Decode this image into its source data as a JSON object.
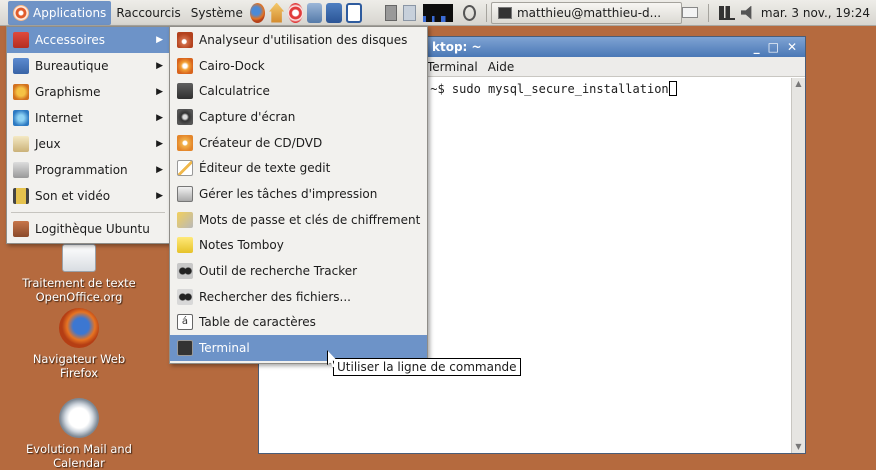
{
  "panel": {
    "menus": [
      "Applications",
      "Raccourcis",
      "Système"
    ],
    "task_label": "matthieu@matthieu-d...",
    "clock": "mar. 3 nov., 19:24"
  },
  "desktop": {
    "icons": [
      {
        "label": "Traitement de texte OpenOffice.org"
      },
      {
        "label": "Navigateur Web Firefox"
      },
      {
        "label": "Evolution Mail and Calendar"
      }
    ]
  },
  "terminal": {
    "title": "ktop: ~",
    "menus": [
      "Terminal",
      "Aide"
    ],
    "prompt_line": ":~$ sudo mysql_secure_installation"
  },
  "main_menu": {
    "items": [
      {
        "label": "Accessoires",
        "icon": "accessories-icon",
        "selected": true
      },
      {
        "label": "Bureautique",
        "icon": "office-icon"
      },
      {
        "label": "Graphisme",
        "icon": "graphics-icon"
      },
      {
        "label": "Internet",
        "icon": "internet-icon"
      },
      {
        "label": "Jeux",
        "icon": "games-icon"
      },
      {
        "label": "Programmation",
        "icon": "programming-icon"
      },
      {
        "label": "Son et vidéo",
        "icon": "sound-video-icon"
      }
    ],
    "footer": {
      "label": "Logithèque Ubuntu",
      "icon": "software-center-icon"
    }
  },
  "sub_menu": {
    "items": [
      {
        "label": "Analyseur d'utilisation des disques",
        "icon": "disk-usage-icon"
      },
      {
        "label": "Cairo-Dock",
        "icon": "cairo-dock-icon"
      },
      {
        "label": "Calculatrice",
        "icon": "calculator-icon"
      },
      {
        "label": "Capture d'écran",
        "icon": "screenshot-icon"
      },
      {
        "label": "Créateur de CD/DVD",
        "icon": "cd-burner-icon"
      },
      {
        "label": "Éditeur de texte gedit",
        "icon": "text-editor-icon"
      },
      {
        "label": "Gérer les tâches d'impression",
        "icon": "printer-icon"
      },
      {
        "label": "Mots de passe et clés de chiffrement",
        "icon": "keys-icon"
      },
      {
        "label": "Notes Tomboy",
        "icon": "notes-icon"
      },
      {
        "label": "Outil de recherche Tracker",
        "icon": "tracker-search-icon"
      },
      {
        "label": "Rechercher des fichiers...",
        "icon": "file-search-icon"
      },
      {
        "label": "Table de caractères",
        "icon": "character-map-icon",
        "glyph": "á"
      },
      {
        "label": "Terminal",
        "icon": "terminal-icon",
        "selected": true
      }
    ]
  },
  "tooltip": {
    "text": "Utiliser la ligne de commande"
  }
}
